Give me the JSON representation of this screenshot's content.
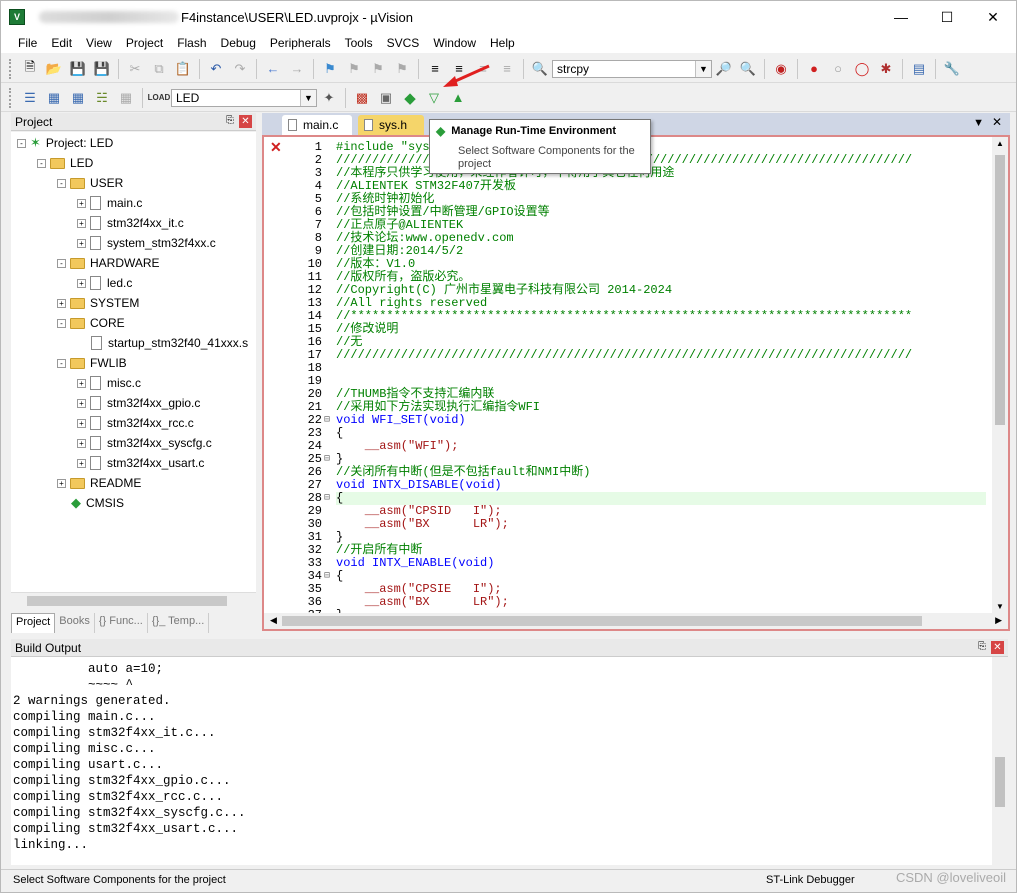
{
  "window": {
    "title": "F4instance\\USER\\LED.uvprojx - µVision",
    "app_icon": "V"
  },
  "menu": [
    "File",
    "Edit",
    "View",
    "Project",
    "Flash",
    "Debug",
    "Peripherals",
    "Tools",
    "SVCS",
    "Window",
    "Help"
  ],
  "toolbar": {
    "find_value": "strcpy",
    "target_value": "LED"
  },
  "project_panel": {
    "title": "Project",
    "root": "Project: LED",
    "target": "LED",
    "groups": [
      {
        "name": "USER",
        "files": [
          "main.c",
          "stm32f4xx_it.c",
          "system_stm32f4xx.c"
        ]
      },
      {
        "name": "HARDWARE",
        "files": [
          "led.c"
        ]
      },
      {
        "name": "SYSTEM",
        "files": []
      },
      {
        "name": "CORE",
        "files": [
          "startup_stm32f40_41xxx.s"
        ]
      },
      {
        "name": "FWLIB",
        "files": [
          "misc.c",
          "stm32f4xx_gpio.c",
          "stm32f4xx_rcc.c",
          "stm32f4xx_syscfg.c",
          "stm32f4xx_usart.c"
        ]
      },
      {
        "name": "README",
        "files": []
      }
    ],
    "cmsis": "CMSIS",
    "tabs": [
      "Project",
      "Books",
      "{} Func...",
      "{}_ Temp..."
    ]
  },
  "editor": {
    "tabs": [
      "main.c",
      "sys.h"
    ],
    "lines": [
      "#include \"sys",
      "////////////////////////////////////////////////////////////////////////////////",
      "//本程序只供学习使用，未经作者许可，不得用于其它任何用途",
      "//ALIENTEK STM32F407开发板",
      "//系统时钟初始化",
      "//包括时钟设置/中断管理/GPIO设置等",
      "//正点原子@ALIENTEK",
      "//技术论坛:www.openedv.com",
      "//创建日期:2014/5/2",
      "//版本：V1.0",
      "//版权所有，盗版必究。",
      "//Copyright(C) 广州市星翼电子科技有限公司 2014-2024",
      "//All rights reserved",
      "//******************************************************************************",
      "//修改说明",
      "//无",
      "////////////////////////////////////////////////////////////////////////////////",
      "",
      "",
      "//THUMB指令不支持汇编内联",
      "//采用如下方法实现执行汇编指令WFI",
      "void WFI_SET(void)",
      "{",
      "    __asm(\"WFI\");",
      "}",
      "//关闭所有中断(但是不包括fault和NMI中断)",
      "void INTX_DISABLE(void)",
      "{",
      "    __asm(\"CPSID   I\");",
      "    __asm(\"BX      LR\");",
      "}",
      "//开启所有中断",
      "void INTX_ENABLE(void)",
      "{",
      "    __asm(\"CPSIE   I\");",
      "    __asm(\"BX      LR\");",
      "}"
    ]
  },
  "tooltip": {
    "title": "Manage Run-Time Environment",
    "desc": "Select Software Components for the project"
  },
  "build_output": {
    "title": "Build Output",
    "lines": [
      "          auto a=10;",
      "          ~~~~ ^",
      "2 warnings generated.",
      "compiling main.c...",
      "compiling stm32f4xx_it.c...",
      "compiling misc.c...",
      "compiling usart.c...",
      "compiling stm32f4xx_gpio.c...",
      "compiling stm32f4xx_rcc.c...",
      "compiling stm32f4xx_syscfg.c...",
      "compiling stm32f4xx_usart.c...",
      "linking..."
    ]
  },
  "status": {
    "left": "Select Software Components for the project",
    "debugger": "ST-Link Debugger",
    "watermark": "CSDN @loveliveoil"
  }
}
